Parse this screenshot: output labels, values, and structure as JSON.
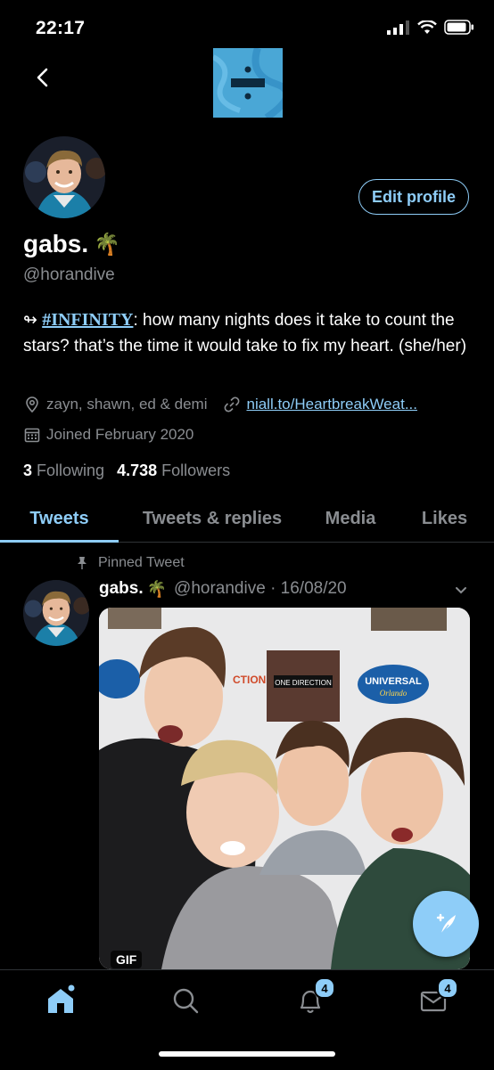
{
  "status_bar": {
    "time": "22:17"
  },
  "profile": {
    "display_name": "gabs.",
    "name_emoji": "🌴",
    "handle": "@horandive",
    "edit_button": "Edit profile",
    "bio_prefix": "↬ ",
    "bio_hashtag": "#INFINITY",
    "bio_text": ": how many nights does it take to count the stars? that’s the time it would take to fix my heart. (she/her)",
    "location": "zayn, shawn, ed & demi",
    "website": "niall.to/HeartbreakWeat...",
    "joined": "Joined February 2020",
    "following_count": "3",
    "following_label": "Following",
    "followers_count": "4.738",
    "followers_label": "Followers"
  },
  "banner": {
    "title_text": "DIVIDE",
    "color": "#4aa7d6"
  },
  "tabs": [
    {
      "label": "Tweets",
      "active": true
    },
    {
      "label": "Tweets & replies",
      "active": false
    },
    {
      "label": "Media",
      "active": false
    },
    {
      "label": "Likes",
      "active": false
    }
  ],
  "tweet": {
    "pinned_label": "Pinned Tweet",
    "name": "gabs.",
    "name_emoji": "🌴",
    "handle_date": "@horandive · 16/08/20",
    "gif_label": "GIF",
    "media_signs": [
      "ONE DIRECTION",
      "UNIVERSAL",
      "Orlando"
    ]
  },
  "bottom_nav": {
    "notifications_badge": "4",
    "messages_badge": "4"
  },
  "colors": {
    "accent": "#8ecdf8",
    "muted": "#8a8d91",
    "background": "#000000"
  },
  "icons": [
    "back-arrow-icon",
    "location-pin-icon",
    "link-icon",
    "calendar-icon",
    "pin-icon",
    "chevron-down-icon",
    "compose-icon",
    "home-icon",
    "search-icon",
    "bell-icon",
    "mail-icon"
  ]
}
